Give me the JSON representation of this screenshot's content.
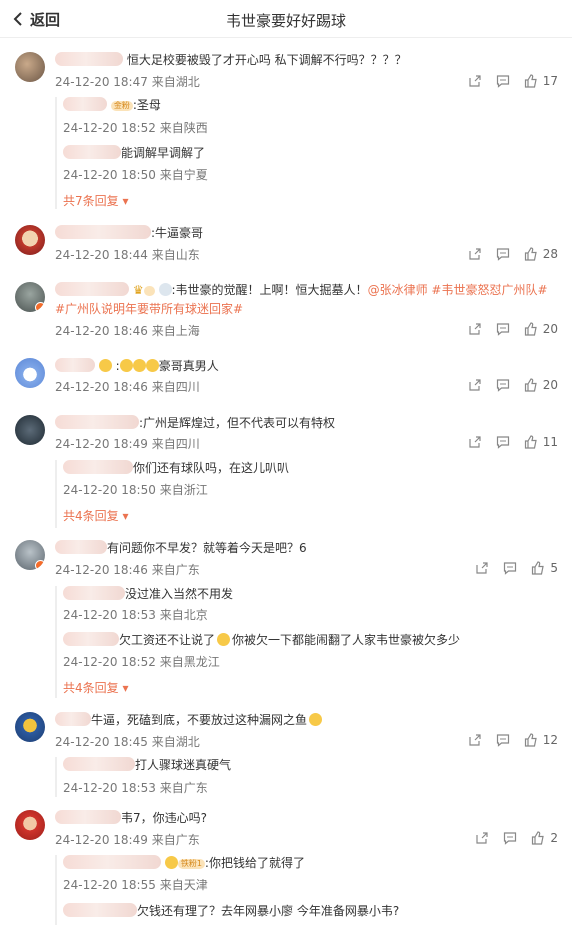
{
  "header": {
    "back_label": "返回",
    "title": "韦世豪要好好踢球"
  },
  "comments": [
    {
      "text": "恒大足校要被毁了才开心吗 私下调解不行吗？？？？",
      "time": "24-12-20 18:47",
      "loc": "来自湖北",
      "likes": "17",
      "replies": [
        {
          "text": ":圣母",
          "time": "24-12-20 18:52",
          "loc": "来自陕西",
          "badge": "金粉"
        },
        {
          "text": "能调解早调解了",
          "time": "24-12-20 18:50",
          "loc": "来自宁夏"
        }
      ],
      "more": "共7条回复"
    },
    {
      "text": ":牛逼豪哥",
      "time": "24-12-20 18:44",
      "loc": "来自山东",
      "likes": "28"
    },
    {
      "text": ":韦世豪的觉醒！上啊！恒大掘墓人！",
      "link1": "@张冰律师",
      "link2": "#韦世豪怒怼广州队#",
      "link3": "#广州队说明年要带所有球迷回家#",
      "time": "24-12-20 18:46",
      "loc": "来自上海",
      "likes": "20"
    },
    {
      "text": "豪哥真男人",
      "time": "24-12-20 18:46",
      "loc": "来自四川",
      "likes": "20"
    },
    {
      "text": ":广州是辉煌过，但不代表可以有特权",
      "time": "24-12-20 18:49",
      "loc": "来自四川",
      "likes": "11",
      "replies": [
        {
          "text": "你们还有球队吗，在这儿叭叭",
          "time": "24-12-20 18:50",
          "loc": "来自浙江"
        }
      ],
      "more": "共4条回复"
    },
    {
      "text": "有问题你不早发？就等着今天是吧？6",
      "time": "24-12-20 18:46",
      "loc": "来自广东",
      "likes": "5",
      "replies": [
        {
          "text": "没过准入当然不用发",
          "time": "24-12-20 18:53",
          "loc": "来自北京"
        },
        {
          "text": "欠工资还不让说了",
          "text2": "你被欠一下都能闹翻了人家韦世豪被欠多少",
          "time": "24-12-20 18:52",
          "loc": "来自黑龙江"
        }
      ],
      "more": "共4条回复"
    },
    {
      "text": "牛逼，死磕到底，不要放过这种漏网之鱼",
      "time": "24-12-20 18:45",
      "loc": "来自湖北",
      "likes": "12",
      "replies": [
        {
          "text": "打人骤球迷真硬气",
          "time": "24-12-20 18:53",
          "loc": "来自广东"
        }
      ]
    },
    {
      "text": "韦7，你违心吗?",
      "time": "24-12-20 18:49",
      "loc": "来自广东",
      "likes": "2",
      "replies": [
        {
          "text": ":你把钱给了就得了",
          "time": "24-12-20 18:55",
          "loc": "来自天津",
          "badge": "铁粉1"
        },
        {
          "text": "欠钱还有理了？去年网暴小廖 今年准备网暴小韦?"
        }
      ]
    }
  ],
  "colors": {
    "accent": "#eb7350",
    "meta": "#777777"
  },
  "icons": [
    "back-icon",
    "share-icon",
    "comment-icon",
    "like-icon",
    "crown-icon",
    "emoji-icon"
  ]
}
